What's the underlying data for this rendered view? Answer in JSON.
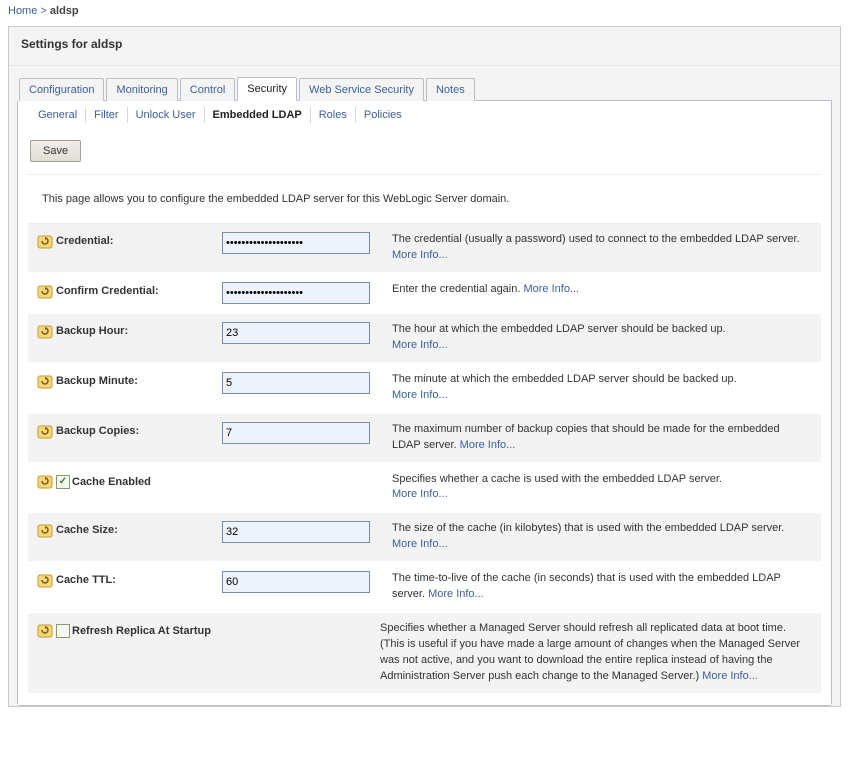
{
  "breadcrumb": {
    "home": "Home",
    "current": "aldsp"
  },
  "panel_title": "Settings for aldsp",
  "tabs1": {
    "configuration": "Configuration",
    "monitoring": "Monitoring",
    "control": "Control",
    "security": "Security",
    "web_service_security": "Web Service Security",
    "notes": "Notes"
  },
  "tabs2": {
    "general": "General",
    "filter": "Filter",
    "unlock_user": "Unlock User",
    "embedded_ldap": "Embedded LDAP",
    "roles": "Roles",
    "policies": "Policies"
  },
  "buttons": {
    "save": "Save"
  },
  "page_description": "This page allows you to configure the embedded LDAP server for this WebLogic Server domain.",
  "more_info": "More Info...",
  "fields": {
    "credential": {
      "label": "Credential:",
      "value": "********************",
      "desc": "The credential (usually a password) used to connect to the embedded LDAP server. "
    },
    "confirm_credential": {
      "label": "Confirm Credential:",
      "value": "********************",
      "desc": "Enter the credential again. "
    },
    "backup_hour": {
      "label": "Backup Hour:",
      "value": "23",
      "desc": "The hour at which the embedded LDAP server should be backed up. "
    },
    "backup_minute": {
      "label": "Backup Minute:",
      "value": "5",
      "desc": "The minute at which the embedded LDAP server should be backed up. "
    },
    "backup_copies": {
      "label": "Backup Copies:",
      "value": "7",
      "desc": "The maximum number of backup copies that should be made for the embedded LDAP server. "
    },
    "cache_enabled": {
      "label": "Cache Enabled",
      "checked": true,
      "desc": "Specifies whether a cache is used with the embedded LDAP server. "
    },
    "cache_size": {
      "label": "Cache Size:",
      "value": "32",
      "desc": "The size of the cache (in kilobytes) that is used with the embedded LDAP server. "
    },
    "cache_ttl": {
      "label": "Cache TTL:",
      "value": "60",
      "desc": "The time-to-live of the cache (in seconds) that is used with the embedded LDAP server. "
    },
    "refresh_replica": {
      "label": "Refresh Replica At Startup",
      "checked": false,
      "desc": "Specifies whether a Managed Server should refresh all replicated data at boot time. (This is useful if you have made a large amount of changes when the Managed Server was not active, and you want to download the entire replica instead of having the Administration Server push each change to the Managed Server.) "
    }
  }
}
